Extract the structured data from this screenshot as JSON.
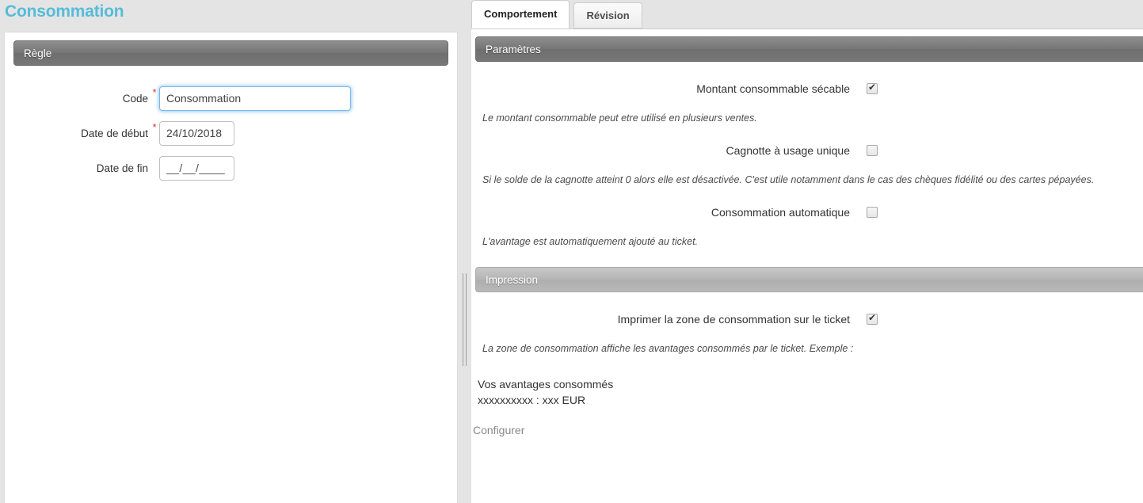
{
  "page": {
    "title": "Consommation"
  },
  "left": {
    "section_title": "Règle",
    "fields": [
      {
        "label": "Code",
        "value": "Consommation",
        "placeholder": "",
        "required_mark": "*"
      },
      {
        "label": "Date de début",
        "value": "24/10/2018",
        "placeholder": "__/__/____",
        "required_mark": "*"
      },
      {
        "label": "Date de fin",
        "value": "",
        "placeholder": "__/__/____",
        "required_mark": ""
      }
    ]
  },
  "right": {
    "tabs": [
      {
        "label": "Comportement",
        "active": true
      },
      {
        "label": "Révision",
        "active": false
      }
    ],
    "parameters": {
      "section_title": "Paramètres",
      "options": [
        {
          "label": "Montant consommable sécable",
          "checked": "true",
          "help": "Le montant consommable peut etre utilisé en plusieurs ventes."
        },
        {
          "label": "Cagnotte à usage unique",
          "checked": "false",
          "help": "Si le solde de la cagnotte atteint 0 alors elle est désactivée. C'est utile notamment dans le cas des chèques fidélité ou des cartes pépayées."
        },
        {
          "label": "Consommation automatique",
          "checked": "false",
          "help": "L'avantage est automatiquement ajouté au ticket."
        }
      ]
    },
    "impression": {
      "section_title": "Impression",
      "option": {
        "label": "Imprimer la zone de consommation sur le ticket",
        "checked": "true",
        "help": "La zone de consommation affiche les avantages consommés par le ticket. Exemple :"
      },
      "example_lines": [
        "Vos avantages consommés",
        "xxxxxxxxxx : xxx EUR"
      ],
      "configure_link": "Configurer"
    }
  },
  "colors": {
    "title": "#55bcd9",
    "section_dark": "#757575",
    "section_light": "#b4b4b4",
    "required": "#e03030",
    "focus_border": "#7db9e8"
  }
}
